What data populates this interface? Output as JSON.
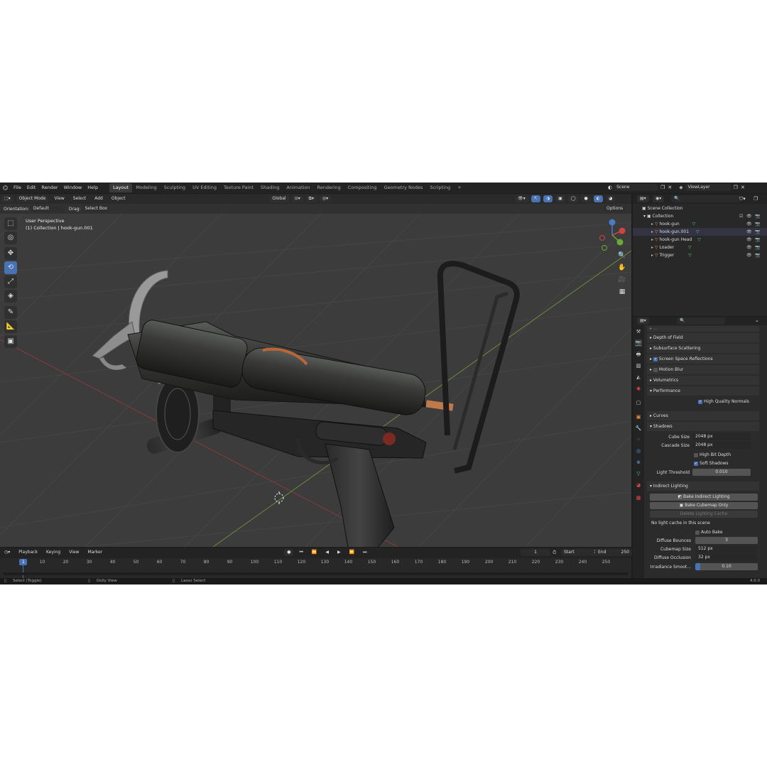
{
  "topbar": {
    "menu": [
      "File",
      "Edit",
      "Render",
      "Window",
      "Help"
    ],
    "workspaces": [
      "Layout",
      "Modeling",
      "Sculpting",
      "UV Editing",
      "Texture Paint",
      "Shading",
      "Animation",
      "Rendering",
      "Compositing",
      "Geometry Nodes",
      "Scripting"
    ],
    "active_workspace": "Layout",
    "add_tab": "+",
    "scene": "Scene",
    "view_layer": "ViewLayer"
  },
  "viewport": {
    "mode": "Object Mode",
    "menus": [
      "View",
      "Select",
      "Add",
      "Object"
    ],
    "transform": "Global",
    "orientation_label": "Orientation:",
    "orientation_value": "Default",
    "drag_label": "Drag:",
    "drag_value": "Select Box",
    "options": "Options",
    "overlay_line1": "User Perspective",
    "overlay_line2": "(1) Collection | hook-gun.001"
  },
  "outliner": {
    "root": "Scene Collection",
    "collection": "Collection",
    "items": [
      "hook-gun",
      "hook-gun.001",
      "hook-gun Head",
      "Loader",
      "Trigger"
    ]
  },
  "properties": {
    "panels": {
      "dof": "Depth of Field",
      "sss": "Subsurface Scattering",
      "ssr": "Screen Space Reflections",
      "motion_blur": "Motion Blur",
      "volumetrics": "Volumetrics",
      "performance": "Performance",
      "hq_normals": "High Quality Normals",
      "curves": "Curves",
      "shadows": "Shadows",
      "indirect": "Indirect Lighting"
    },
    "shadows": {
      "cube_size_label": "Cube Size",
      "cube_size": "2048 px",
      "cascade_size_label": "Cascade Size",
      "cascade_size": "2048 px",
      "high_bit_depth": "High Bit Depth",
      "soft_shadows": "Soft Shadows",
      "light_threshold_label": "Light Threshold",
      "light_threshold": "0.010"
    },
    "indirect": {
      "bake_indirect": "Bake Indirect Lighting",
      "bake_cubemap": "Bake Cubemap Only",
      "delete_cache": "Delete Lighting Cache",
      "no_cache": "No light cache in this scene",
      "auto_bake": "Auto Bake",
      "diffuse_bounces_label": "Diffuse Bounces",
      "diffuse_bounces": "3",
      "cubemap_size_label": "Cubemap Size",
      "cubemap_size": "512 px",
      "diffuse_occlusion_label": "Diffuse Occlusion",
      "diffuse_occlusion": "32 px",
      "irradiance_label": "Irradiance Smoot...",
      "irradiance": "0.10"
    }
  },
  "timeline": {
    "menus": [
      "Playback",
      "Keying",
      "View",
      "Marker"
    ],
    "current_frame": "1",
    "start_label": "Start",
    "start": "1",
    "end_label": "End",
    "end": "250",
    "ticks": [
      "1",
      "10",
      "20",
      "30",
      "40",
      "50",
      "60",
      "70",
      "80",
      "90",
      "100",
      "110",
      "120",
      "130",
      "140",
      "150",
      "160",
      "170",
      "180",
      "190",
      "200",
      "210",
      "220",
      "230",
      "240",
      "250"
    ]
  },
  "statusbar": {
    "select": "Select (Toggle)",
    "dolly": "Dolly View",
    "lasso": "Lasso Select",
    "version": "4.0.0"
  },
  "colors": {
    "accent": "#4772b3",
    "viewport_bg": "#3c3c3c"
  }
}
